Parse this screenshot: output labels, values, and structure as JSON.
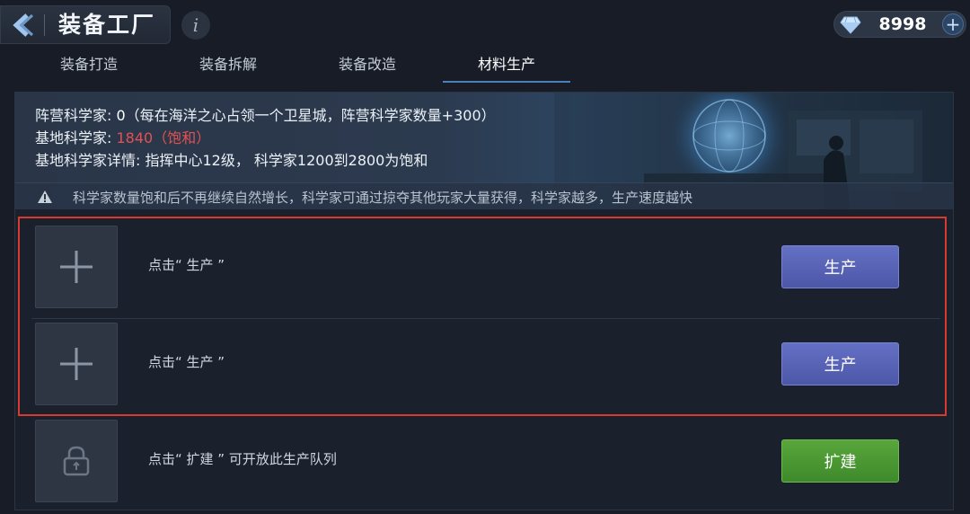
{
  "header": {
    "title": "装备工厂",
    "info_icon": "i",
    "currency_value": "8998",
    "currency_plus": "+"
  },
  "tabs": [
    {
      "label": "装备打造",
      "active": false
    },
    {
      "label": "装备拆解",
      "active": false
    },
    {
      "label": "装备改造",
      "active": false
    },
    {
      "label": "材料生产",
      "active": true
    }
  ],
  "banner": {
    "line1_label": "阵营科学家: ",
    "line1_value": "0",
    "line1_note": "（每在海洋之心占领一个卫星城，阵营科学家数量+300）",
    "line2_label": "基地科学家: ",
    "line2_value": "1840（饱和）",
    "line3": "基地科学家详情: 指挥中心12级， 科学家1200到2800为饱和",
    "warning": "科学家数量饱和后不再继续自然增长，科学家可通过掠夺其他玩家大量获得，科学家越多，生产速度越快"
  },
  "slots": [
    {
      "icon": "plus-icon",
      "text": "点击“ 生产 ”",
      "button": "生产"
    },
    {
      "icon": "plus-icon",
      "text": "点击“ 生产 ”",
      "button": "生产"
    },
    {
      "icon": "lock-icon",
      "text": "点击“ 扩建 ” 可开放此生产队列",
      "button": "扩建"
    }
  ],
  "colors": {
    "background": "#171c27",
    "highlight_border": "#d93a30",
    "produce_button": "#5a64b8",
    "expand_button": "#4a9634",
    "saturated_text": "#e25252"
  },
  "icons": [
    "back-arrow-icon",
    "info-icon",
    "gem-icon",
    "add-icon",
    "warning-icon",
    "plus-icon",
    "lock-icon"
  ]
}
